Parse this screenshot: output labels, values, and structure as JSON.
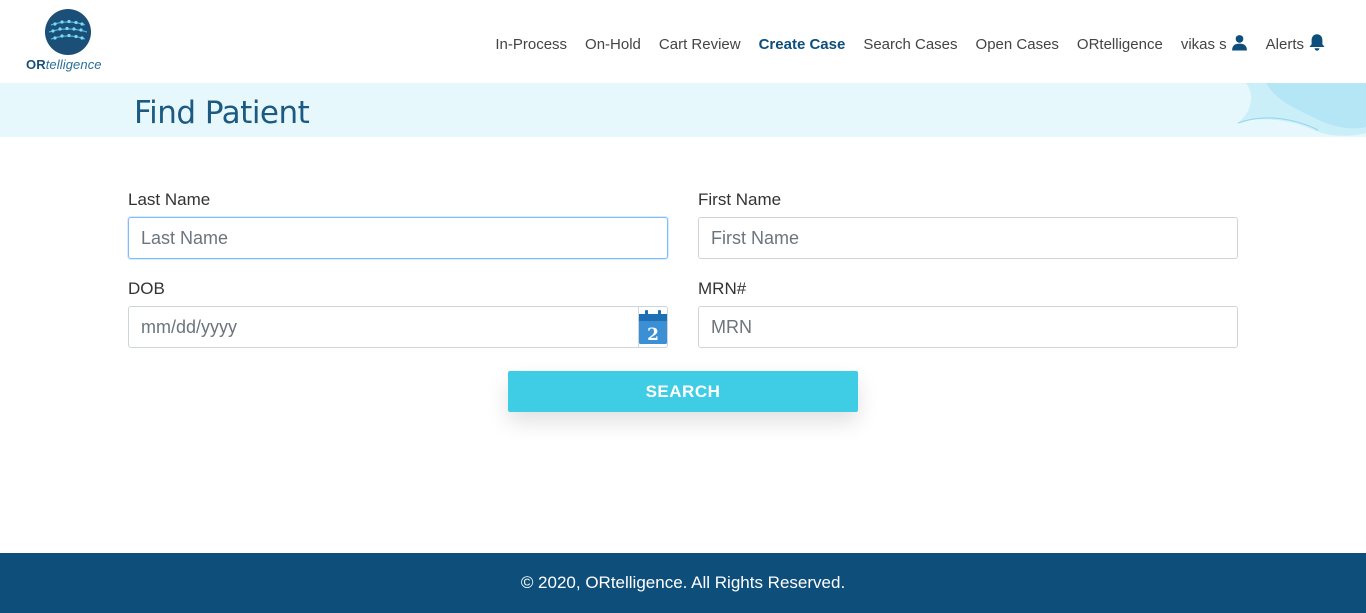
{
  "brand": {
    "logo_bold": "OR",
    "logo_rest": "telligence"
  },
  "nav": {
    "items": [
      {
        "label": "In-Process"
      },
      {
        "label": "On-Hold"
      },
      {
        "label": "Cart Review"
      },
      {
        "label": "Create Case",
        "active": true
      },
      {
        "label": "Search Cases"
      },
      {
        "label": "Open Cases"
      },
      {
        "label": "ORtelligence"
      }
    ],
    "user": {
      "label": "vikas s",
      "icon": "user-icon"
    },
    "alerts": {
      "label": "Alerts",
      "icon": "bell-icon"
    }
  },
  "page": {
    "title": "Find Patient"
  },
  "form": {
    "last_name": {
      "label": "Last Name",
      "placeholder": "Last Name",
      "value": ""
    },
    "first_name": {
      "label": "First Name",
      "placeholder": "First Name",
      "value": ""
    },
    "dob": {
      "label": "DOB",
      "placeholder": "mm/dd/yyyy",
      "value": "",
      "calendar_icon": "calendar-icon",
      "calendar_day": "2"
    },
    "mrn": {
      "label": "MRN#",
      "placeholder": "MRN",
      "value": ""
    },
    "search_label": "SEARCH"
  },
  "footer": {
    "text": "© 2020, ORtelligence. All Rights Reserved."
  },
  "colors": {
    "primary": "#0e4e7a",
    "accent": "#3fcde6",
    "band": "#e6f8fc",
    "nav_active": "#0e4e7a"
  }
}
